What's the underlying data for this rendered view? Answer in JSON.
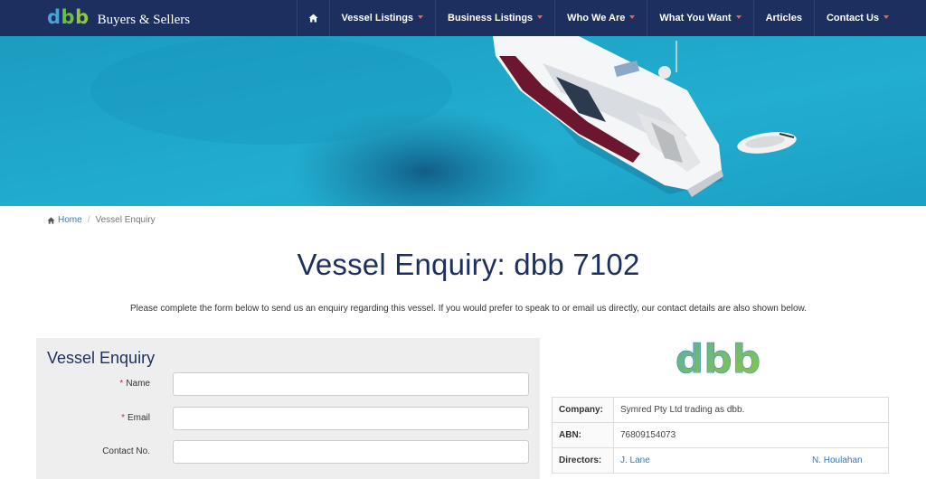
{
  "brand": {
    "mark_d": "d",
    "mark_b1": "b",
    "mark_b2": "b",
    "name": "Buyers & Sellers"
  },
  "nav": {
    "items": [
      {
        "label": "Vessel Listings",
        "dropdown": true
      },
      {
        "label": "Business Listings",
        "dropdown": true
      },
      {
        "label": "Who We Are",
        "dropdown": true
      },
      {
        "label": "What You Want",
        "dropdown": true
      },
      {
        "label": "Articles",
        "dropdown": false
      },
      {
        "label": "Contact Us",
        "dropdown": true
      }
    ]
  },
  "breadcrumb": {
    "home": "Home",
    "current": "Vessel Enquiry"
  },
  "page": {
    "title": "Vessel Enquiry: dbb 7102",
    "intro": "Please complete the form below to send us an enquiry regarding this vessel. If you would prefer to speak to or email us directly, our contact details are also shown below."
  },
  "form": {
    "title": "Vessel Enquiry",
    "required_mark": "*",
    "fields": {
      "name": {
        "label": "Name",
        "value": "",
        "placeholder": ""
      },
      "email": {
        "label": "Email",
        "value": "",
        "placeholder": ""
      },
      "contact": {
        "label": "Contact No.",
        "value": "",
        "placeholder": ""
      }
    }
  },
  "company": {
    "logo_text": "dbb",
    "rows": {
      "company_label": "Company:",
      "company_value": "Symred Pty Ltd trading as dbb.",
      "abn_label": "ABN:",
      "abn_value": "76809154073",
      "directors_label": "Directors:",
      "director_1": "J. Lane",
      "director_2": "N. Houlahan"
    }
  },
  "colors": {
    "navbar": "#1c2f5e",
    "accent_caret": "#e9634a",
    "link": "#337ab7",
    "title": "#1c2f5e",
    "brand_blue": "#4aa3d8",
    "brand_green": "#8fc93a"
  },
  "icons": {
    "nav_home": "home-icon",
    "breadcrumb_home": "home-icon"
  }
}
